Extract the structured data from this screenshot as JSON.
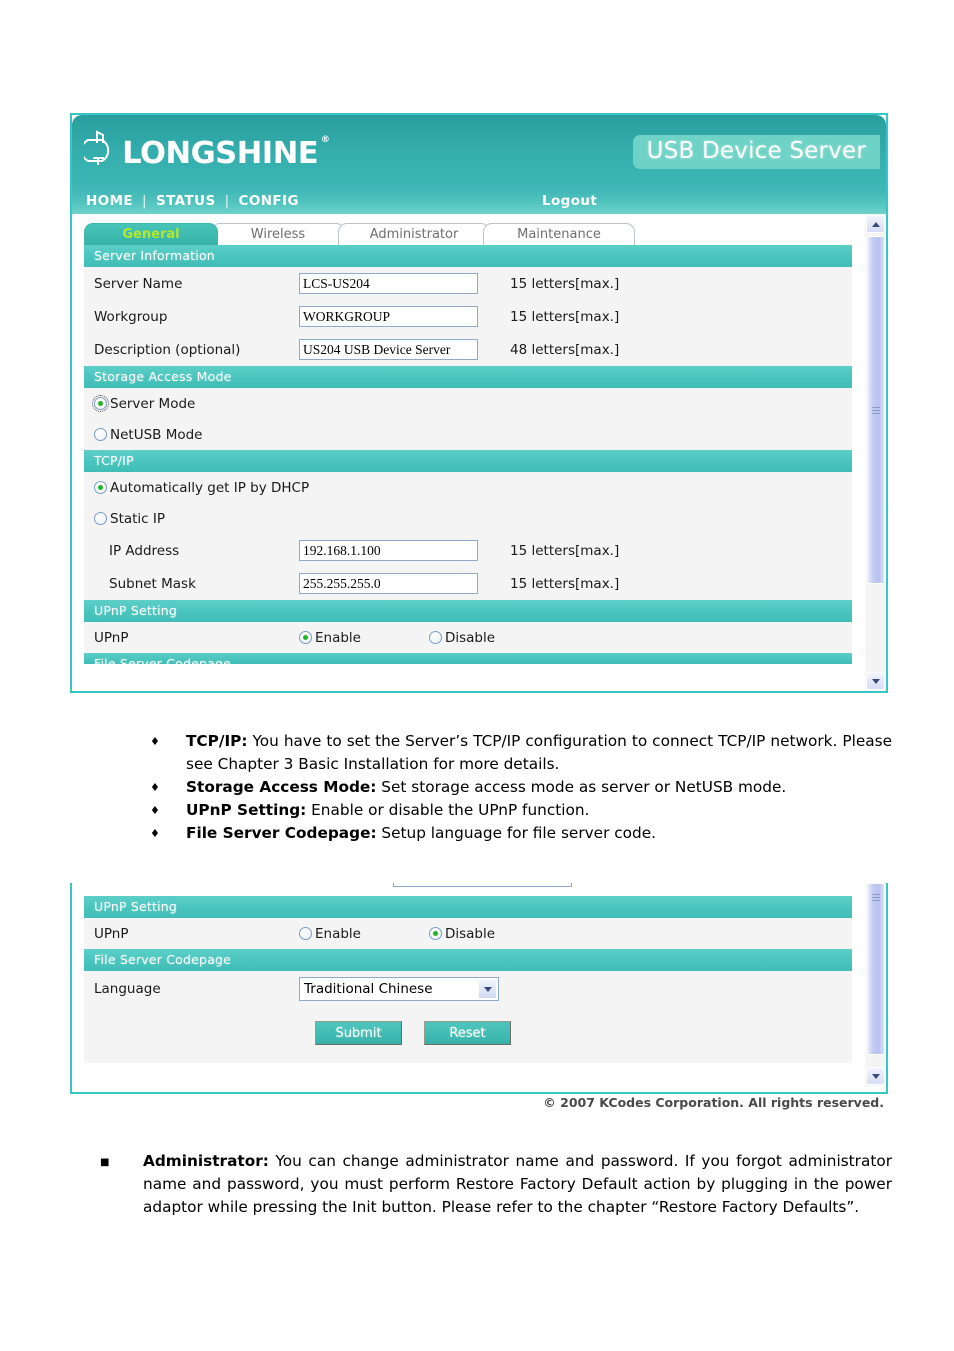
{
  "window": {
    "brand": "LONGSHINE",
    "brand_registered": "®",
    "product_badge": "USB Device Server",
    "nav": {
      "home": "HOME",
      "separator": "|",
      "status": "STATUS",
      "config": "CONFIG",
      "logout": "Logout"
    },
    "footer": "© 2007 KCodes Corporation. All rights reserved."
  },
  "tabs": [
    {
      "label": "General",
      "active": true
    },
    {
      "label": "Wireless",
      "active": false
    },
    {
      "label": "Administrator",
      "active": false
    },
    {
      "label": "Maintenance",
      "active": false
    }
  ],
  "panel_top": {
    "sections": {
      "server_information": {
        "title": "Server Information",
        "fields": [
          {
            "label": "Server Name",
            "value": "LCS-US204",
            "hint": "15 letters[max.]"
          },
          {
            "label": "Workgroup",
            "value": "WORKGROUP",
            "hint": "15 letters[max.]"
          },
          {
            "label": "Description (optional)",
            "value": "US204 USB Device Server",
            "hint": "48 letters[max.]"
          }
        ]
      },
      "storage_access_mode": {
        "title": "Storage Access Mode",
        "options": [
          {
            "label": "Server Mode",
            "selected": true
          },
          {
            "label": "NetUSB Mode",
            "selected": false
          }
        ]
      },
      "tcpip": {
        "title": "TCP/IP",
        "options": [
          {
            "label": "Automatically get IP by DHCP",
            "selected": true
          },
          {
            "label": "Static IP",
            "selected": false
          }
        ],
        "fields": [
          {
            "label": "IP Address",
            "value": "192.168.1.100",
            "hint": "15 letters[max.]"
          },
          {
            "label": "Subnet Mask",
            "value": "255.255.255.0",
            "hint": "15 letters[max.]"
          }
        ]
      },
      "upnp_setting": {
        "title": "UPnP Setting",
        "field_label": "UPnP",
        "options": [
          {
            "label": "Enable",
            "selected": true
          },
          {
            "label": "Disable",
            "selected": false
          }
        ]
      },
      "file_server_codepage": {
        "title": "File Server Codepage"
      }
    }
  },
  "panel_bottom": {
    "sections": {
      "upnp_setting": {
        "title": "UPnP Setting",
        "field_label": "UPnP",
        "options": [
          {
            "label": "Enable",
            "selected": false
          },
          {
            "label": "Disable",
            "selected": true
          }
        ]
      },
      "file_server_codepage": {
        "title": "File Server Codepage",
        "field_label": "Language",
        "language_value": "Traditional Chinese"
      }
    },
    "buttons": {
      "submit": "Submit",
      "reset": "Reset"
    }
  },
  "prose_mid": [
    {
      "term": "TCP/IP:",
      "text": " You have to set the Server’s TCP/IP configuration to connect TCP/IP network. Please see Chapter 3 Basic Installation for more details."
    },
    {
      "term": "Storage Access Mode:",
      "text": " Set storage access mode as server or NetUSB mode."
    },
    {
      "term": "UPnP Setting:",
      "text": " Enable or disable the UPnP function."
    },
    {
      "term": "File Server Codepage:",
      "text": " Setup language for file server code."
    }
  ],
  "prose_bottom": [
    {
      "term": "Administrator:",
      "text": " You can change administrator name and password. If you forgot administrator name and password, you must perform Restore Factory Default action by plugging in the power adaptor while pressing the Init button. Please refer to the chapter “Restore Factory Defaults”."
    }
  ],
  "colors": {
    "header_teal": "#35aeae",
    "section_bar": "#4cc6bf",
    "active_tab_text": "#b5e82a",
    "frame_border": "#35c6c6",
    "radio_dot": "#24b324"
  }
}
